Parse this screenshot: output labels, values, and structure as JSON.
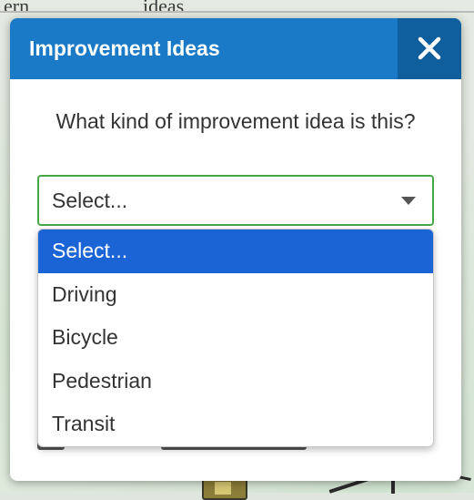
{
  "background_map": {
    "label_left": "ern",
    "label_right": "ideas"
  },
  "dialog": {
    "title": "Improvement Ideas",
    "close_icon": "close-icon",
    "question": "What kind of improvement idea is this?",
    "select": {
      "value": "Select...",
      "arrow_icon": "caret-down-icon",
      "options": [
        "Select...",
        "Driving",
        "Bicycle",
        "Pedestrian",
        "Transit"
      ],
      "highlighted_index": 0
    }
  },
  "colors": {
    "header": "#1a7ac7",
    "close_button": "#0f5e9e",
    "select_border": "#44a744",
    "highlight": "#1a64d6"
  }
}
